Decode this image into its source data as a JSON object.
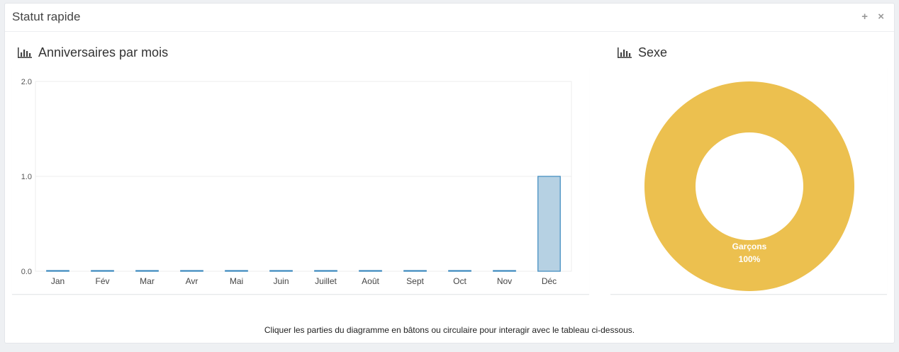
{
  "panel": {
    "title": "Statut rapide",
    "add_symbol": "+",
    "close_symbol": "×"
  },
  "bar_section": {
    "title": "Anniversaires par mois"
  },
  "pie_section": {
    "title": "Sexe"
  },
  "footer_note": "Cliquer les parties du diagramme en bâtons ou circulaire pour interagir avec le tableau ci-dessous.",
  "colors": {
    "bar_fill": "#b6d1e3",
    "bar_stroke": "#3b88be",
    "donut": "#ecc04f"
  },
  "chart_data": [
    {
      "type": "bar",
      "title": "Anniversaires par mois",
      "categories": [
        "Jan",
        "Fév",
        "Mar",
        "Avr",
        "Mai",
        "Juin",
        "Juillet",
        "Août",
        "Sept",
        "Oct",
        "Nov",
        "Déc"
      ],
      "values": [
        0,
        0,
        0,
        0,
        0,
        0,
        0,
        0,
        0,
        0,
        0,
        1
      ],
      "ylim": [
        0,
        2
      ],
      "yticks": [
        "0.0",
        "1.0",
        "2.0"
      ],
      "grid": true
    },
    {
      "type": "pie",
      "title": "Sexe",
      "donut": true,
      "slices": [
        {
          "label": "Garçons",
          "value": 100,
          "percent_label": "100%"
        }
      ]
    }
  ]
}
